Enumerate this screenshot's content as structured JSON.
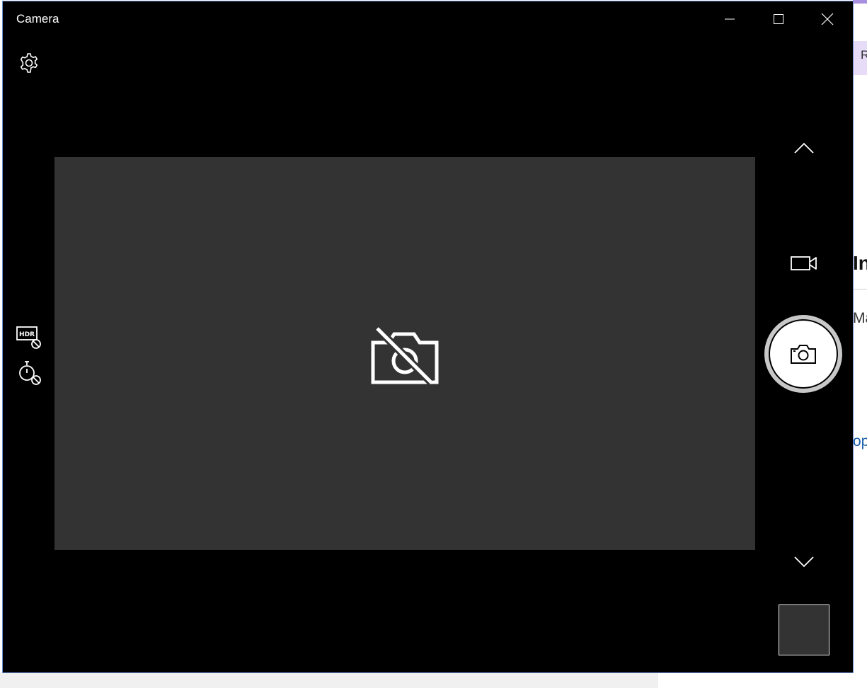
{
  "window": {
    "title": "Camera"
  },
  "controls": {
    "settings_icon": "gear-icon",
    "hdr_icon": "hdr-off-icon",
    "hdr_label": "HDR",
    "timer_icon": "timer-off-icon",
    "mode_up_icon": "chevron-up-icon",
    "video_mode_icon": "video-camera-icon",
    "shutter_icon": "camera-icon",
    "mode_down_icon": "chevron-down-icon"
  },
  "preview": {
    "status_icon": "camera-unavailable-icon"
  },
  "background": {
    "r_letter": "R",
    "heading_fragment": "In",
    "text_fragment": "Ma",
    "link_fragment": "op"
  },
  "colors": {
    "window_bg": "#000000",
    "preview_bg": "#333333",
    "accent_border": "#6b8fd6",
    "link": "#1a5fa8"
  }
}
